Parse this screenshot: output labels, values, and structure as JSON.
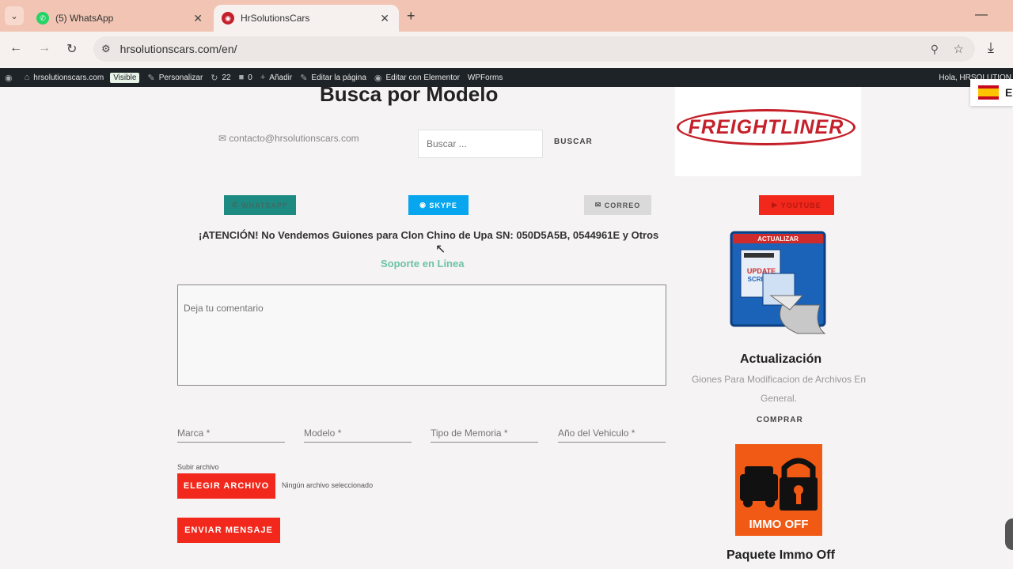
{
  "browser": {
    "tabs": [
      {
        "title": "(5) WhatsApp",
        "active": false
      },
      {
        "title": "HrSolutionsCars",
        "active": true
      }
    ],
    "url": "hrsolutionscars.com/en/"
  },
  "adminbar": {
    "site": "hrsolutionscars.com",
    "visibility": "Visible",
    "customize": "Personalizar",
    "updates": "22",
    "comments": "0",
    "add_new": "Añadir",
    "edit_page": "Editar la página",
    "elementor": "Editar con Elementor",
    "wpforms": "WPForms",
    "howdy": "Hola, HRSOLUTION"
  },
  "main": {
    "heading": "Busca por Modelo",
    "contact_email": "contacto@hrsolutionscars.com",
    "search": {
      "placeholder": "Buscar ...",
      "button": "BUSCAR"
    },
    "brand_logo": "FREIGHTLINER",
    "social": {
      "whatsapp": "WHATSAPP",
      "skype": "SKYPE",
      "correo": "CORREO",
      "youtube": "YOUTUBE"
    },
    "attention": "¡ATENCIÓN! No Vendemos Guiones para Clon Chino de Upa SN: 050D5A5B, 0544961E y Otros",
    "support": "Soporte en Linea",
    "form": {
      "comment_placeholder": "Deja tu comentario",
      "marca": "Marca *",
      "modelo": "Modelo *",
      "tipo_memoria": "Tipo de Memoria *",
      "anio": "Año del Vehiculo *",
      "upload_label": "Subir archivo",
      "choose_button": "ELEGIR ARCHIVO",
      "no_file": "Ningún archivo seleccionado",
      "send_button": "ENVIAR MENSAJE"
    }
  },
  "sidebar": {
    "update_image_top": "ACTUALIZAR",
    "update_image_text": "UPDATE SCRIPTS",
    "update_title": "Actualización",
    "update_desc": "Giones Para Modificacion de Archivos En General.",
    "buy": "COMPRAR",
    "immo_image_text": "IMMO OFF",
    "immo_title": "Paquete Immo Off"
  },
  "lang": {
    "letter": "E"
  }
}
